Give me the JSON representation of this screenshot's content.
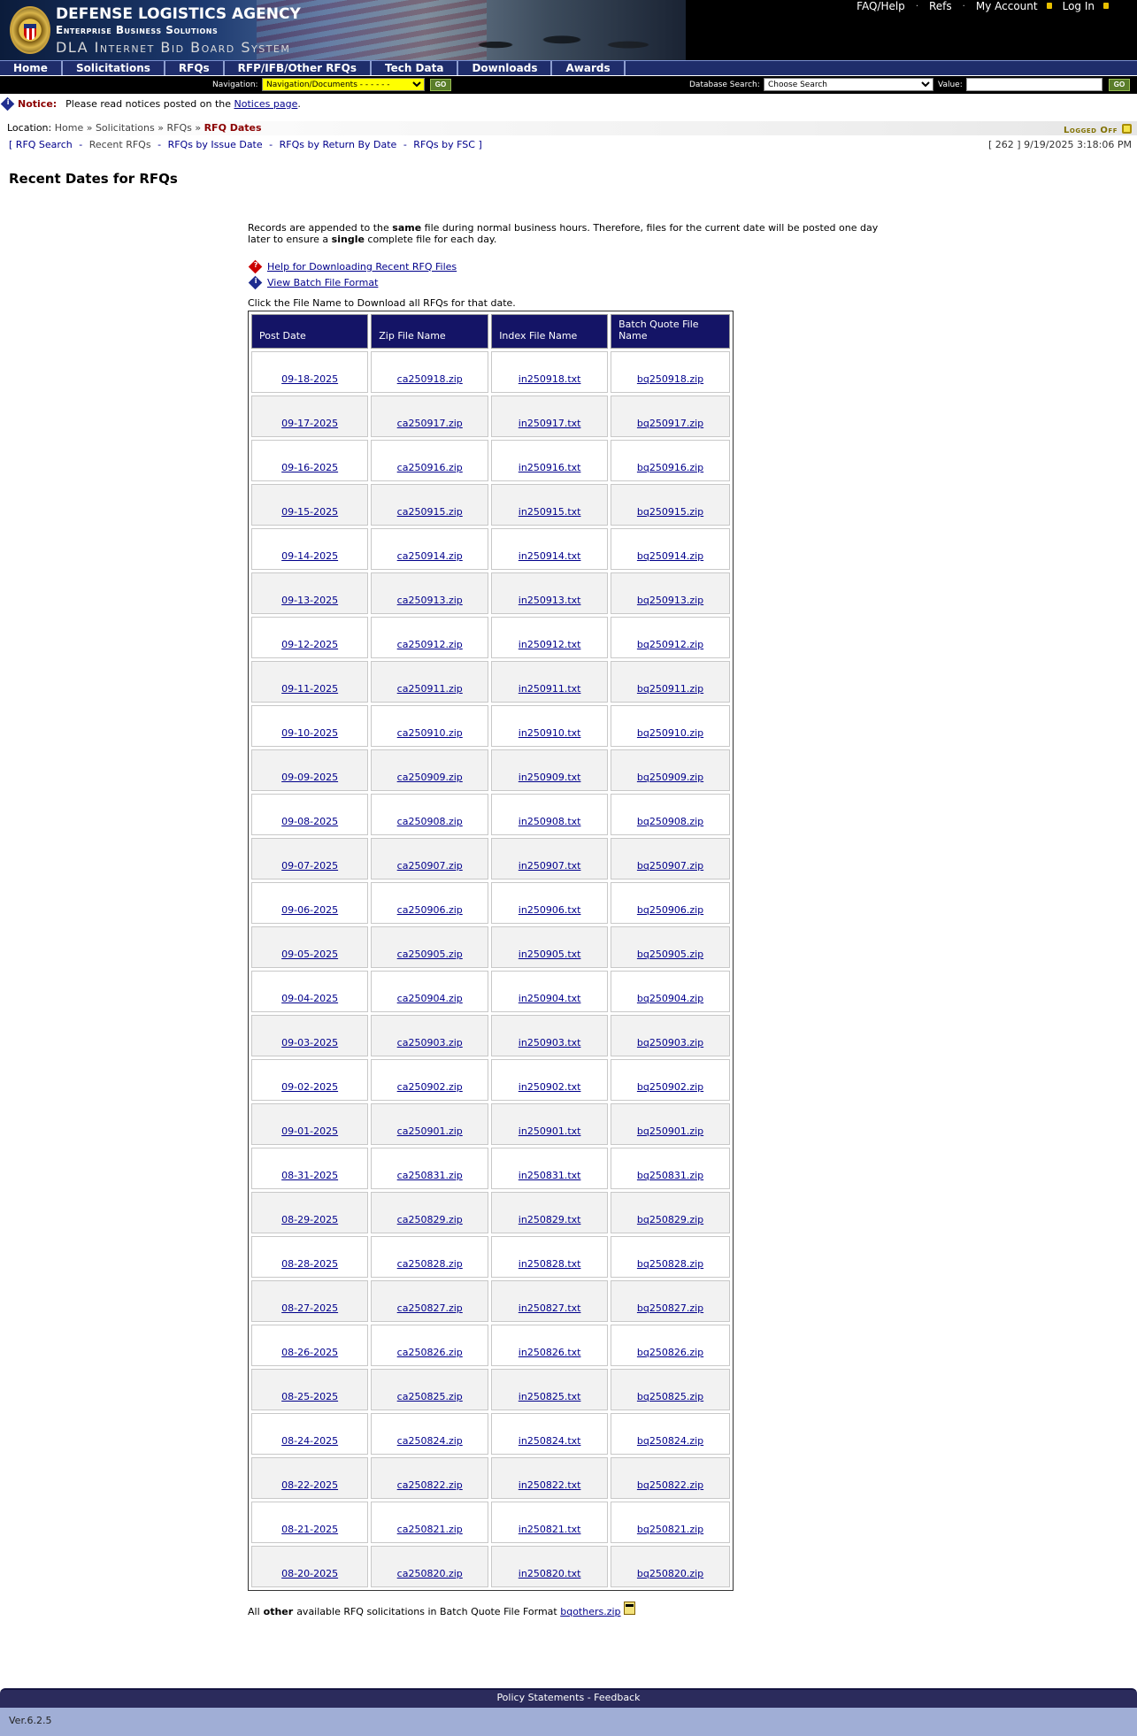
{
  "header": {
    "line1": "DEFENSE LOGISTICS AGENCY",
    "line2": "Enterprise Business Solutions",
    "line3": "DLA Internet Bid Board System",
    "links": [
      "FAQ/Help",
      "Refs",
      "My Account",
      "Log In"
    ]
  },
  "nav": {
    "items": [
      "Home",
      "Solicitations",
      "RFQs",
      "RFP/IFB/Other RFQs",
      "Tech Data",
      "Downloads",
      "Awards"
    ],
    "navigation_label": "Navigation:",
    "navigation_value": "Navigation/Documents - - - - - -",
    "go_label": "GO",
    "db_search_label": "Database Search:",
    "db_search_value": "Choose Search",
    "value_label": "Value:",
    "value_input": ""
  },
  "notice": {
    "label": "Notice:",
    "text": "Please read notices posted on the",
    "link": "Notices page",
    "end": "."
  },
  "location": {
    "label": "Location:",
    "crumbs": [
      "Home",
      "Solicitations",
      "RFQs"
    ],
    "current": "RFQ Dates",
    "logged_status": "Logged Off"
  },
  "sublinks": [
    "RFQ Search",
    "Recent RFQs",
    "RFQs by Issue Date",
    "RFQs by Return By Date",
    "RFQs by FSC"
  ],
  "status": "[ 262 ] 9/19/2025 3:18:06 PM",
  "page_title": "Recent Dates for RFQs",
  "intro": {
    "t1": "Records are appended to the ",
    "b1": "same",
    "t2": " file during normal business hours.    Therefore, files for the current date will be posted one day later to ensure a ",
    "b2": "single",
    "t3": " complete file for each day."
  },
  "help_links": {
    "download_help": "Help for Downloading Recent RFQ Files",
    "batch_format": "View Batch File Format"
  },
  "click_hint": "Click the File Name to Download all RFQs for that date.",
  "table": {
    "headers": [
      "Post Date",
      "Zip File Name",
      "Index File Name",
      "Batch Quote File Name"
    ],
    "rows": [
      [
        "09-18-2025",
        "ca250918.zip",
        "in250918.txt",
        "bq250918.zip"
      ],
      [
        "09-17-2025",
        "ca250917.zip",
        "in250917.txt",
        "bq250917.zip"
      ],
      [
        "09-16-2025",
        "ca250916.zip",
        "in250916.txt",
        "bq250916.zip"
      ],
      [
        "09-15-2025",
        "ca250915.zip",
        "in250915.txt",
        "bq250915.zip"
      ],
      [
        "09-14-2025",
        "ca250914.zip",
        "in250914.txt",
        "bq250914.zip"
      ],
      [
        "09-13-2025",
        "ca250913.zip",
        "in250913.txt",
        "bq250913.zip"
      ],
      [
        "09-12-2025",
        "ca250912.zip",
        "in250912.txt",
        "bq250912.zip"
      ],
      [
        "09-11-2025",
        "ca250911.zip",
        "in250911.txt",
        "bq250911.zip"
      ],
      [
        "09-10-2025",
        "ca250910.zip",
        "in250910.txt",
        "bq250910.zip"
      ],
      [
        "09-09-2025",
        "ca250909.zip",
        "in250909.txt",
        "bq250909.zip"
      ],
      [
        "09-08-2025",
        "ca250908.zip",
        "in250908.txt",
        "bq250908.zip"
      ],
      [
        "09-07-2025",
        "ca250907.zip",
        "in250907.txt",
        "bq250907.zip"
      ],
      [
        "09-06-2025",
        "ca250906.zip",
        "in250906.txt",
        "bq250906.zip"
      ],
      [
        "09-05-2025",
        "ca250905.zip",
        "in250905.txt",
        "bq250905.zip"
      ],
      [
        "09-04-2025",
        "ca250904.zip",
        "in250904.txt",
        "bq250904.zip"
      ],
      [
        "09-03-2025",
        "ca250903.zip",
        "in250903.txt",
        "bq250903.zip"
      ],
      [
        "09-02-2025",
        "ca250902.zip",
        "in250902.txt",
        "bq250902.zip"
      ],
      [
        "09-01-2025",
        "ca250901.zip",
        "in250901.txt",
        "bq250901.zip"
      ],
      [
        "08-31-2025",
        "ca250831.zip",
        "in250831.txt",
        "bq250831.zip"
      ],
      [
        "08-29-2025",
        "ca250829.zip",
        "in250829.txt",
        "bq250829.zip"
      ],
      [
        "08-28-2025",
        "ca250828.zip",
        "in250828.txt",
        "bq250828.zip"
      ],
      [
        "08-27-2025",
        "ca250827.zip",
        "in250827.txt",
        "bq250827.zip"
      ],
      [
        "08-26-2025",
        "ca250826.zip",
        "in250826.txt",
        "bq250826.zip"
      ],
      [
        "08-25-2025",
        "ca250825.zip",
        "in250825.txt",
        "bq250825.zip"
      ],
      [
        "08-24-2025",
        "ca250824.zip",
        "in250824.txt",
        "bq250824.zip"
      ],
      [
        "08-22-2025",
        "ca250822.zip",
        "in250822.txt",
        "bq250822.zip"
      ],
      [
        "08-21-2025",
        "ca250821.zip",
        "in250821.txt",
        "bq250821.zip"
      ],
      [
        "08-20-2025",
        "ca250820.zip",
        "in250820.txt",
        "bq250820.zip"
      ]
    ]
  },
  "other": {
    "pre": "All",
    "bold": "other",
    "post": "available RFQ solicitations in Batch Quote File Format",
    "link": "bqothers.zip"
  },
  "footer": {
    "policy": "Policy Statements",
    "sep": " - ",
    "feedback": "Feedback",
    "version": "Ver.6.2.5"
  },
  "colors": {
    "nav_bg": "#1f2d6b",
    "table_header_bg": "#141466",
    "current_crumb": "#8b0000",
    "link": "#00008b"
  }
}
